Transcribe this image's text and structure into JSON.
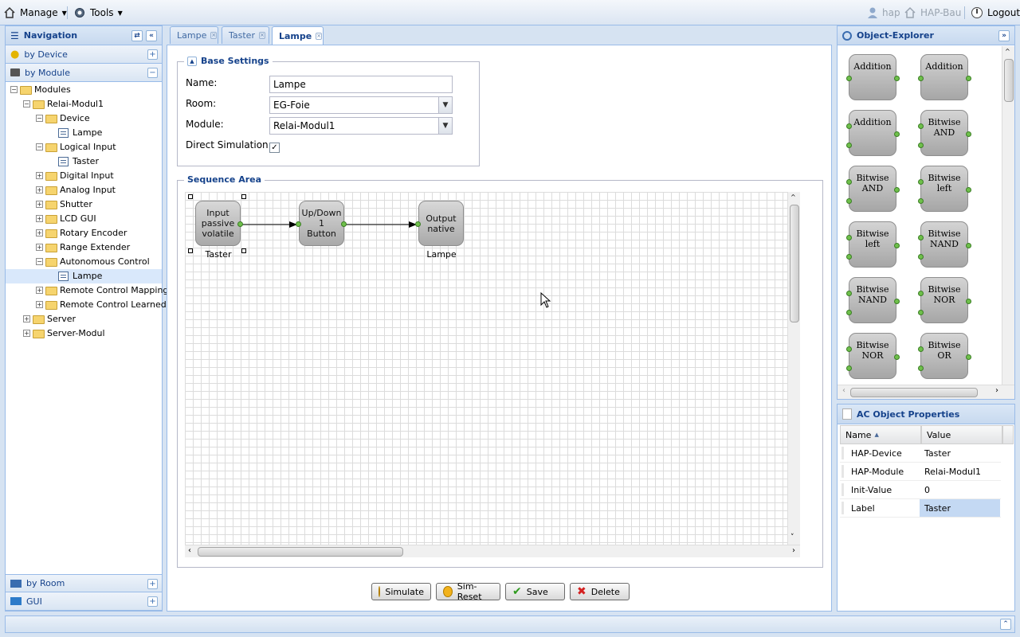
{
  "topbar": {
    "manage_label": "Manage",
    "tools_label": "Tools",
    "user_label": "hap",
    "project_label": "HAP-Bau",
    "logout_label": "Logout"
  },
  "navigation": {
    "title": "Navigation",
    "sections": {
      "by_device": "by Device",
      "by_module": "by Module",
      "by_room": "by Room",
      "gui": "GUI"
    },
    "tree": [
      {
        "label": "Modules",
        "type": "folder",
        "expander": "−"
      },
      {
        "label": "Relai-Modul1",
        "type": "folder",
        "expander": "−"
      },
      {
        "label": "Device",
        "type": "folder",
        "expander": "−"
      },
      {
        "label": "Lampe",
        "type": "file"
      },
      {
        "label": "Logical Input",
        "type": "folder",
        "expander": "−"
      },
      {
        "label": "Taster",
        "type": "file"
      },
      {
        "label": "Digital Input",
        "type": "folder",
        "expander": "+"
      },
      {
        "label": "Analog Input",
        "type": "folder",
        "expander": "+"
      },
      {
        "label": "Shutter",
        "type": "folder",
        "expander": "+"
      },
      {
        "label": "LCD GUI",
        "type": "folder",
        "expander": "+"
      },
      {
        "label": "Rotary Encoder",
        "type": "folder",
        "expander": "+"
      },
      {
        "label": "Range Extender",
        "type": "folder",
        "expander": "+"
      },
      {
        "label": "Autonomous Control",
        "type": "folder",
        "expander": "−"
      },
      {
        "label": "Lampe",
        "type": "file",
        "selected": true
      },
      {
        "label": "Remote Control Mapping",
        "type": "folder",
        "expander": "+"
      },
      {
        "label": "Remote Control Learned",
        "type": "folder",
        "expander": "+"
      },
      {
        "label": "Server",
        "type": "folder",
        "expander": "+"
      },
      {
        "label": "Server-Modul",
        "type": "folder",
        "expander": "+"
      }
    ]
  },
  "tabs": [
    {
      "label": "Lampe",
      "active": false
    },
    {
      "label": "Taster",
      "active": false
    },
    {
      "label": "Lampe",
      "active": true
    }
  ],
  "base_settings": {
    "legend": "Base Settings",
    "name_label": "Name:",
    "name_value": "Lampe",
    "room_label": "Room:",
    "room_value": "EG-Foie",
    "module_label": "Module:",
    "module_value": "Relai-Modul1",
    "direct_sim_label": "Direct Simulation:",
    "direct_sim_checked": true
  },
  "sequence": {
    "legend": "Sequence Area",
    "nodes": [
      {
        "text": "Input\npassive\nvolatile",
        "label": "Taster"
      },
      {
        "text": "Up/Down 1\nButton",
        "label": ""
      },
      {
        "text": "Output\nnative",
        "label": "Lampe"
      }
    ]
  },
  "buttons": {
    "simulate": "Simulate",
    "sim_reset": "Sim-Reset",
    "save": "Save",
    "delete": "Delete"
  },
  "object_explorer": {
    "title": "Object-Explorer",
    "objects": [
      "Addition",
      "Addition",
      "Addition",
      "Bitwise\nAND",
      "Bitwise\nAND",
      "Bitwise\nleft",
      "Bitwise\nleft",
      "Bitwise\nNAND",
      "Bitwise\nNAND",
      "Bitwise\nNOR",
      "Bitwise\nNOR",
      "Bitwise\nOR"
    ]
  },
  "properties": {
    "title": "AC Object Properties",
    "col_name": "Name",
    "col_value": "Value",
    "rows": [
      {
        "name": "HAP-Device",
        "value": "Taster"
      },
      {
        "name": "HAP-Module",
        "value": "Relai-Modul1"
      },
      {
        "name": "Init-Value",
        "value": "0"
      },
      {
        "name": "Label",
        "value": "Taster"
      }
    ]
  },
  "colors": {
    "header_text": "#15428b",
    "border": "#99bbe8",
    "port_green": "#6fc04b"
  }
}
